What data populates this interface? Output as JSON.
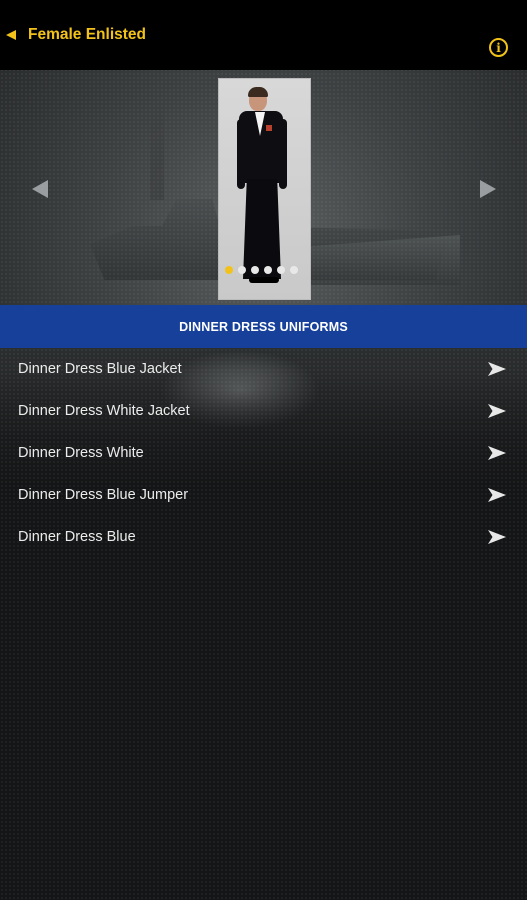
{
  "header": {
    "title": "Female Enlisted",
    "back_icon": "back-arrow-icon",
    "info_icon": "info-icon",
    "info_glyph": "i"
  },
  "colors": {
    "accent": "#f2c21a",
    "section_bar": "#17409a",
    "topbar": "#000000"
  },
  "carousel": {
    "prev_icon": "chevron-left-icon",
    "next_icon": "chevron-right-icon",
    "dot_count": 6,
    "active_index": 0
  },
  "section": {
    "title": "DINNER DRESS UNIFORMS"
  },
  "list": {
    "items": [
      {
        "label": "Dinner Dress Blue Jacket"
      },
      {
        "label": "Dinner Dress White Jacket"
      },
      {
        "label": "Dinner Dress White"
      },
      {
        "label": "Dinner Dress Blue Jumper"
      },
      {
        "label": "Dinner Dress Blue"
      }
    ],
    "item_icon": "chevron-right-icon"
  }
}
